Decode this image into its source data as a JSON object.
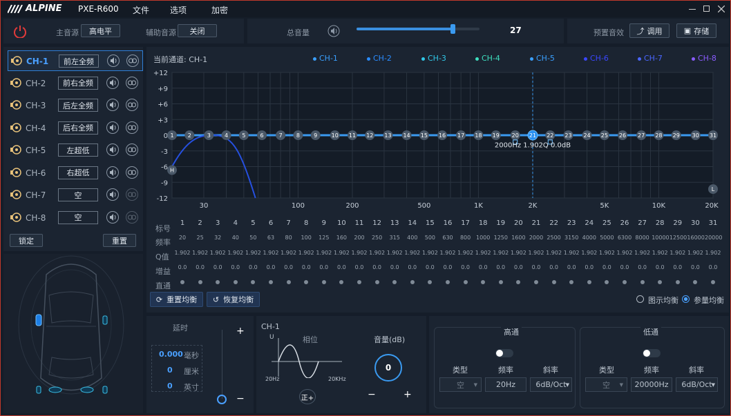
{
  "titlebar": {
    "brand": "ALPINE",
    "model": "PXE-R600",
    "menus": [
      "文件",
      "选项",
      "加密"
    ]
  },
  "top": {
    "main_source_label": "主音源",
    "main_source_value": "高电平",
    "aux_source_label": "辅助音源",
    "aux_source_value": "关闭",
    "master_vol_label": "总音量",
    "master_vol_value": "27",
    "master_vol_fraction": 0.78,
    "preset_label": "预置音效",
    "recall_label": "调用",
    "save_label": "存储"
  },
  "channels": [
    {
      "id": "CH-1",
      "name": "前左全频"
    },
    {
      "id": "CH-2",
      "name": "前右全频"
    },
    {
      "id": "CH-3",
      "name": "后左全频"
    },
    {
      "id": "CH-4",
      "name": "后右全频"
    },
    {
      "id": "CH-5",
      "name": "左超低"
    },
    {
      "id": "CH-6",
      "name": "右超低"
    },
    {
      "id": "CH-7",
      "name": "空"
    },
    {
      "id": "CH-8",
      "name": "空"
    }
  ],
  "lock_label": "锁定",
  "reset_label": "重置",
  "eq": {
    "current_label": "当前通道: CH-1",
    "legend": [
      {
        "name": "CH-1",
        "color": "#3aa0ff"
      },
      {
        "name": "CH-2",
        "color": "#2a8cff"
      },
      {
        "name": "CH-3",
        "color": "#30c8e8"
      },
      {
        "name": "CH-4",
        "color": "#3ee0c0"
      },
      {
        "name": "CH-5",
        "color": "#3aa0ff"
      },
      {
        "name": "CH-6",
        "color": "#3a46ff"
      },
      {
        "name": "CH-7",
        "color": "#4a66ff"
      },
      {
        "name": "CH-8",
        "color": "#8a5cff"
      }
    ],
    "y_ticks": [
      "+12",
      "+9",
      "+6",
      "+3",
      "0",
      "-3",
      "-6",
      "-9",
      "-12"
    ],
    "x_ticks": [
      "30",
      "100",
      "200",
      "500",
      "1K",
      "2K",
      "5K",
      "10K",
      "20K"
    ],
    "selected_info": "2000Hz  1.902Q  0.0dB",
    "marker_h": "H",
    "marker_l": "L",
    "row_labels": {
      "num": "标号",
      "freq": "频率",
      "q": "Q值",
      "gain": "增益",
      "bypass": "直通"
    },
    "bands": [
      {
        "n": "1",
        "f": "20"
      },
      {
        "n": "2",
        "f": "25"
      },
      {
        "n": "3",
        "f": "32"
      },
      {
        "n": "4",
        "f": "40"
      },
      {
        "n": "5",
        "f": "50"
      },
      {
        "n": "6",
        "f": "63"
      },
      {
        "n": "7",
        "f": "80"
      },
      {
        "n": "8",
        "f": "100"
      },
      {
        "n": "9",
        "f": "125"
      },
      {
        "n": "10",
        "f": "160"
      },
      {
        "n": "11",
        "f": "200"
      },
      {
        "n": "12",
        "f": "250"
      },
      {
        "n": "13",
        "f": "315"
      },
      {
        "n": "14",
        "f": "400"
      },
      {
        "n": "15",
        "f": "500"
      },
      {
        "n": "16",
        "f": "630"
      },
      {
        "n": "17",
        "f": "800"
      },
      {
        "n": "18",
        "f": "1000"
      },
      {
        "n": "19",
        "f": "1250"
      },
      {
        "n": "20",
        "f": "1600"
      },
      {
        "n": "21",
        "f": "2000"
      },
      {
        "n": "22",
        "f": "2500"
      },
      {
        "n": "23",
        "f": "3150"
      },
      {
        "n": "24",
        "f": "4000"
      },
      {
        "n": "25",
        "f": "5000"
      },
      {
        "n": "26",
        "f": "6300"
      },
      {
        "n": "27",
        "f": "8000"
      },
      {
        "n": "28",
        "f": "10000"
      },
      {
        "n": "29",
        "f": "12500"
      },
      {
        "n": "30",
        "f": "16000"
      },
      {
        "n": "31",
        "f": "20000"
      }
    ],
    "q_value": "1.902",
    "gain_value": "0.0",
    "reset_eq_label": "重置均衡",
    "restore_eq_label": "恢复均衡",
    "mode_graphic": "图示均衡",
    "mode_param": "参量均衡"
  },
  "delay": {
    "title": "延时",
    "ms": "0.000",
    "ms_unit": "毫秒",
    "cm": "0",
    "cm_unit": "厘米",
    "inch": "0",
    "inch_unit": "英寸",
    "plus": "+",
    "minus": "−"
  },
  "phase": {
    "channel": "CH-1",
    "title": "相位",
    "u": "U",
    "f_low": "20Hz",
    "f_high": "20KHz",
    "phase_btn": "正+"
  },
  "volume": {
    "title": "音量(dB)",
    "value": "0",
    "minus": "−",
    "plus": "+"
  },
  "highpass": {
    "title": "高通",
    "type_label": "类型",
    "freq_label": "频率",
    "slope_label": "斜率",
    "type_value": "空",
    "freq_value": "20Hz",
    "slope_value": "6dB/Oct"
  },
  "lowpass": {
    "title": "低通",
    "type_label": "类型",
    "freq_label": "频率",
    "slope_label": "斜率",
    "type_value": "空",
    "freq_value": "20000Hz",
    "slope_value": "6dB/Oct"
  }
}
